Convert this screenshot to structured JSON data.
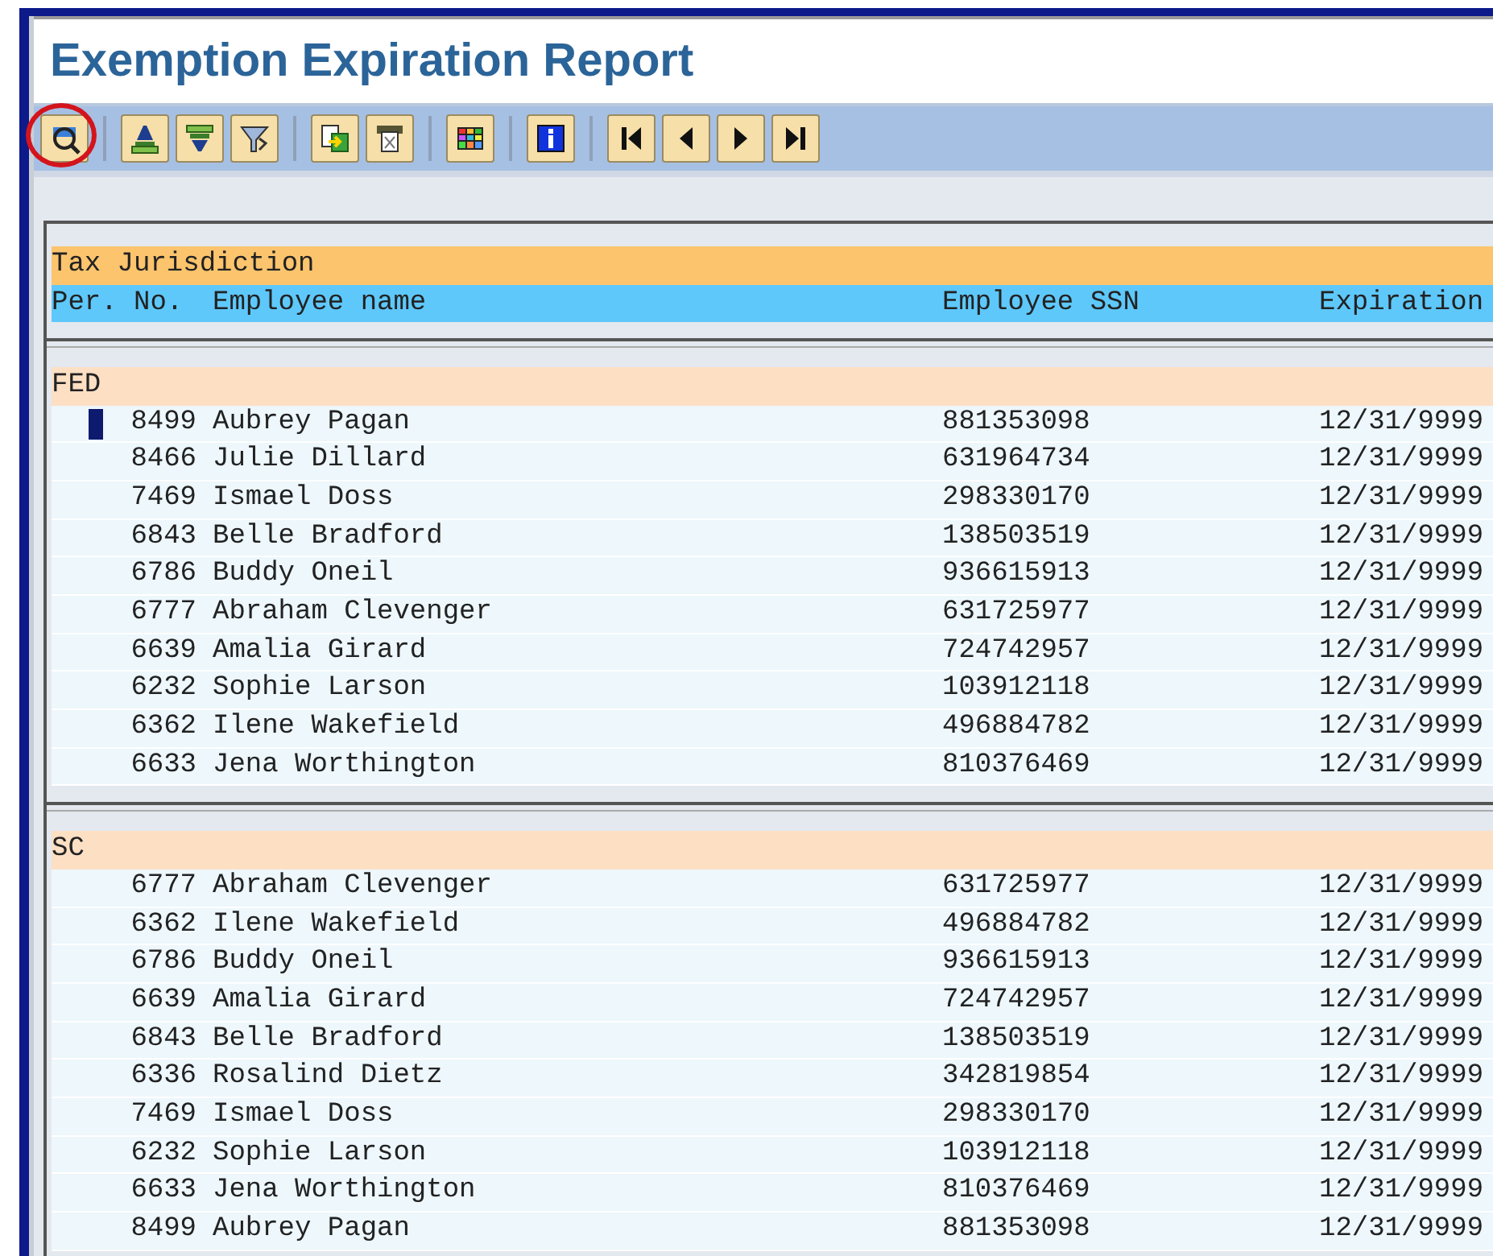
{
  "title": "Exemption Expiration Report",
  "toolbar": [
    [
      {
        "circled": true
      }
    ],
    [
      {
        "circled": false
      },
      {
        "circled": false
      },
      {
        "circled": false
      }
    ],
    [
      {
        "circled": false
      },
      {
        "circled": false
      }
    ],
    [
      {
        "circled": false
      }
    ],
    [
      {
        "circled": false
      }
    ],
    [
      {
        "circled": false
      },
      {
        "circled": false
      },
      {
        "circled": false
      },
      {
        "circled": false
      }
    ]
  ],
  "table": {
    "group_heading": "Tax Jurisdiction",
    "columns": [
      "Per. No.",
      "Employee name",
      "Employee SSN",
      "Expiration"
    ],
    "groups": [
      {
        "name": "FED",
        "rows": [
          {
            "per_no": "8499",
            "name": "Aubrey Pagan",
            "ssn": "881353098",
            "expiration": "12/31/9999",
            "cursor": true
          },
          {
            "per_no": "8466",
            "name": "Julie Dillard",
            "ssn": "631964734",
            "expiration": "12/31/9999",
            "cursor": false
          },
          {
            "per_no": "7469",
            "name": "Ismael Doss",
            "ssn": "298330170",
            "expiration": "12/31/9999",
            "cursor": false
          },
          {
            "per_no": "6843",
            "name": "Belle Bradford",
            "ssn": "138503519",
            "expiration": "12/31/9999",
            "cursor": false
          },
          {
            "per_no": "6786",
            "name": "Buddy Oneil",
            "ssn": "936615913",
            "expiration": "12/31/9999",
            "cursor": false
          },
          {
            "per_no": "6777",
            "name": "Abraham Clevenger",
            "ssn": "631725977",
            "expiration": "12/31/9999",
            "cursor": false
          },
          {
            "per_no": "6639",
            "name": "Amalia Girard",
            "ssn": "724742957",
            "expiration": "12/31/9999",
            "cursor": false
          },
          {
            "per_no": "6232",
            "name": "Sophie Larson",
            "ssn": "103912118",
            "expiration": "12/31/9999",
            "cursor": false
          },
          {
            "per_no": "6362",
            "name": "Ilene Wakefield",
            "ssn": "496884782",
            "expiration": "12/31/9999",
            "cursor": false
          },
          {
            "per_no": "6633",
            "name": "Jena Worthington",
            "ssn": "810376469",
            "expiration": "12/31/9999",
            "cursor": false
          }
        ]
      },
      {
        "name": "SC",
        "rows": [
          {
            "per_no": "6777",
            "name": "Abraham Clevenger",
            "ssn": "631725977",
            "expiration": "12/31/9999",
            "cursor": false
          },
          {
            "per_no": "6362",
            "name": "Ilene Wakefield",
            "ssn": "496884782",
            "expiration": "12/31/9999",
            "cursor": false
          },
          {
            "per_no": "6786",
            "name": "Buddy Oneil",
            "ssn": "936615913",
            "expiration": "12/31/9999",
            "cursor": false
          },
          {
            "per_no": "6639",
            "name": "Amalia Girard",
            "ssn": "724742957",
            "expiration": "12/31/9999",
            "cursor": false
          },
          {
            "per_no": "6843",
            "name": "Belle Bradford",
            "ssn": "138503519",
            "expiration": "12/31/9999",
            "cursor": false
          },
          {
            "per_no": "6336",
            "name": "Rosalind Dietz",
            "ssn": "342819854",
            "expiration": "12/31/9999",
            "cursor": false
          },
          {
            "per_no": "7469",
            "name": "Ismael Doss",
            "ssn": "298330170",
            "expiration": "12/31/9999",
            "cursor": false
          },
          {
            "per_no": "6232",
            "name": "Sophie Larson",
            "ssn": "103912118",
            "expiration": "12/31/9999",
            "cursor": false
          },
          {
            "per_no": "6633",
            "name": "Jena Worthington",
            "ssn": "810376469",
            "expiration": "12/31/9999",
            "cursor": false
          },
          {
            "per_no": "8499",
            "name": "Aubrey Pagan",
            "ssn": "881353098",
            "expiration": "12/31/9999",
            "cursor": false
          }
        ]
      }
    ]
  }
}
